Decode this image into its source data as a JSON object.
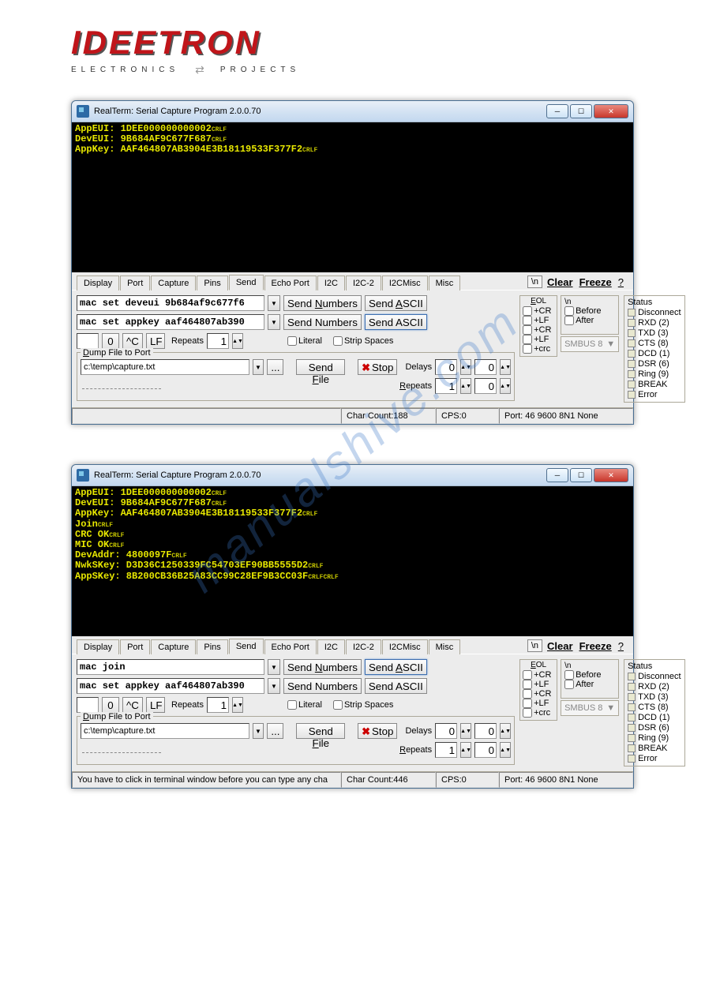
{
  "logo": {
    "main": "IDEETRON",
    "sub1": "ELECTRONICS",
    "sub2": "PROJECTS"
  },
  "win1": {
    "title": "RealTerm: Serial Capture Program 2.0.0.70",
    "terminal": "AppEUI: 1DEE000000000002\nDevEUI: 9B684AF9C677F687\nAppKey: AAF464807AB3904E3B18119533F377F2",
    "cmd1": "mac set deveui 9b684af9c677f6",
    "cmd2": "mac set appkey aaf464807ab390",
    "status": {
      "charcount": "Char Count:188",
      "cps": "CPS:0",
      "port": "Port: 46 9600 8N1 None"
    }
  },
  "win2": {
    "title": "RealTerm: Serial Capture Program 2.0.0.70",
    "terminal": "AppEUI: 1DEE000000000002\nDevEUI: 9B684AF9C677F687\nAppKey: AAF464807AB3904E3B18119533F377F2\nJoin\nCRC OK\nMIC OK\nDevAddr: 4800097F\nNwkSKey: D3D36C1250339FC54703EF90BB5555D2\nAppSKey: 8B200CB36B25A83CC99C28EF9B3CC03F",
    "cmd1": "mac join",
    "cmd2": "mac set appkey aaf464807ab390",
    "status": {
      "hint": "You have to click in terminal window before you can type any cha",
      "charcount": "Char Count:446",
      "cps": "CPS:0",
      "port": "Port: 46 9600 8N1 None"
    }
  },
  "tabs": [
    "Display",
    "Port",
    "Capture",
    "Pins",
    "Send",
    "Echo Port",
    "I2C",
    "I2C-2",
    "I2CMisc",
    "Misc"
  ],
  "buttons": {
    "sendNumbers": "Send Numbers",
    "sendAscii": "Send ASCII",
    "sendFile": "Send File",
    "stop": "Stop",
    "zero": "0",
    "hatC": "^C",
    "lf": "LF",
    "repeats": "Repeats",
    "repeatsVal": "1",
    "literal": "Literal",
    "stripSpaces": "Strip Spaces",
    "browse": "...",
    "delays": "Delays",
    "delayVal1": "0",
    "delayVal2": "0",
    "repeats2": "Repeats",
    "repeats2v1": "1",
    "repeats2v2": "0",
    "clear": "Clear",
    "freeze": "Freeze",
    "help": "?",
    "slashn": "\\n"
  },
  "eol": {
    "title": "EOL",
    "cr": "+CR",
    "lf": "+LF",
    "crc": "+crc"
  },
  "slashnBox": {
    "before": "Before",
    "after": "After"
  },
  "smbus": "SMBUS 8",
  "statusBox": {
    "title": "Status",
    "items": [
      "Disconnect",
      "RXD (2)",
      "TXD (3)",
      "CTS (8)",
      "DCD (1)",
      "DSR (6)",
      "Ring (9)",
      "BREAK",
      "Error"
    ]
  },
  "dump": {
    "title": "Dump File to Port",
    "path": "c:\\temp\\capture.txt"
  },
  "watermark": "manualshive.com"
}
